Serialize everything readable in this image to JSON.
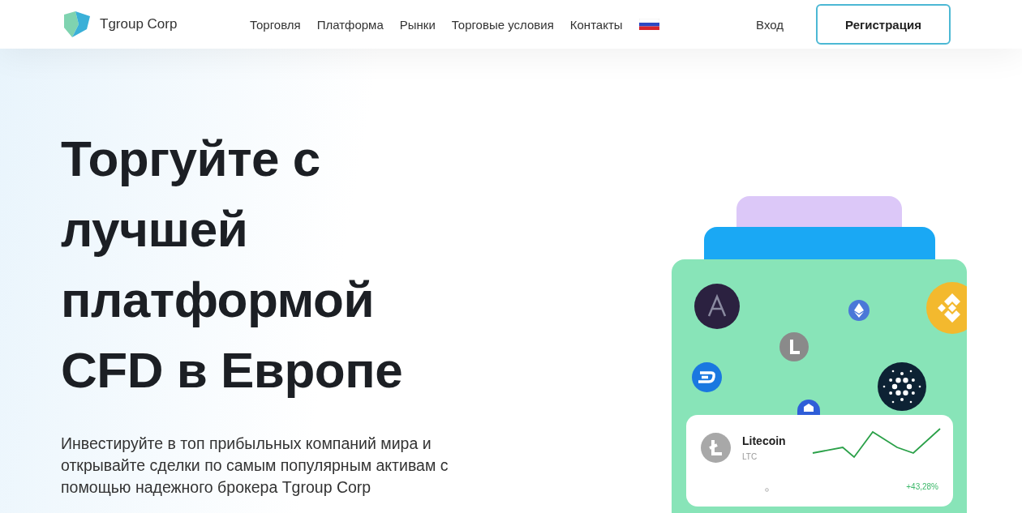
{
  "header": {
    "brand": "Tgroup Corp",
    "nav": [
      "Торговля",
      "Платформа",
      "Рынки",
      "Торговые условия",
      "Контакты"
    ],
    "login": "Вход",
    "register": "Регистрация"
  },
  "hero": {
    "headline": [
      "Торгуйте с",
      "лучшей",
      "платформой",
      "CFD в Европе"
    ],
    "text": "Инвестируйте в топ прибыльных компаний мира и открывайте сделки по самым популярным активам с помощью надежного брокера Tgroup Corp"
  },
  "coin_card": {
    "name": "Litecoin",
    "ticker": "LTC",
    "change": "+43,28%"
  }
}
